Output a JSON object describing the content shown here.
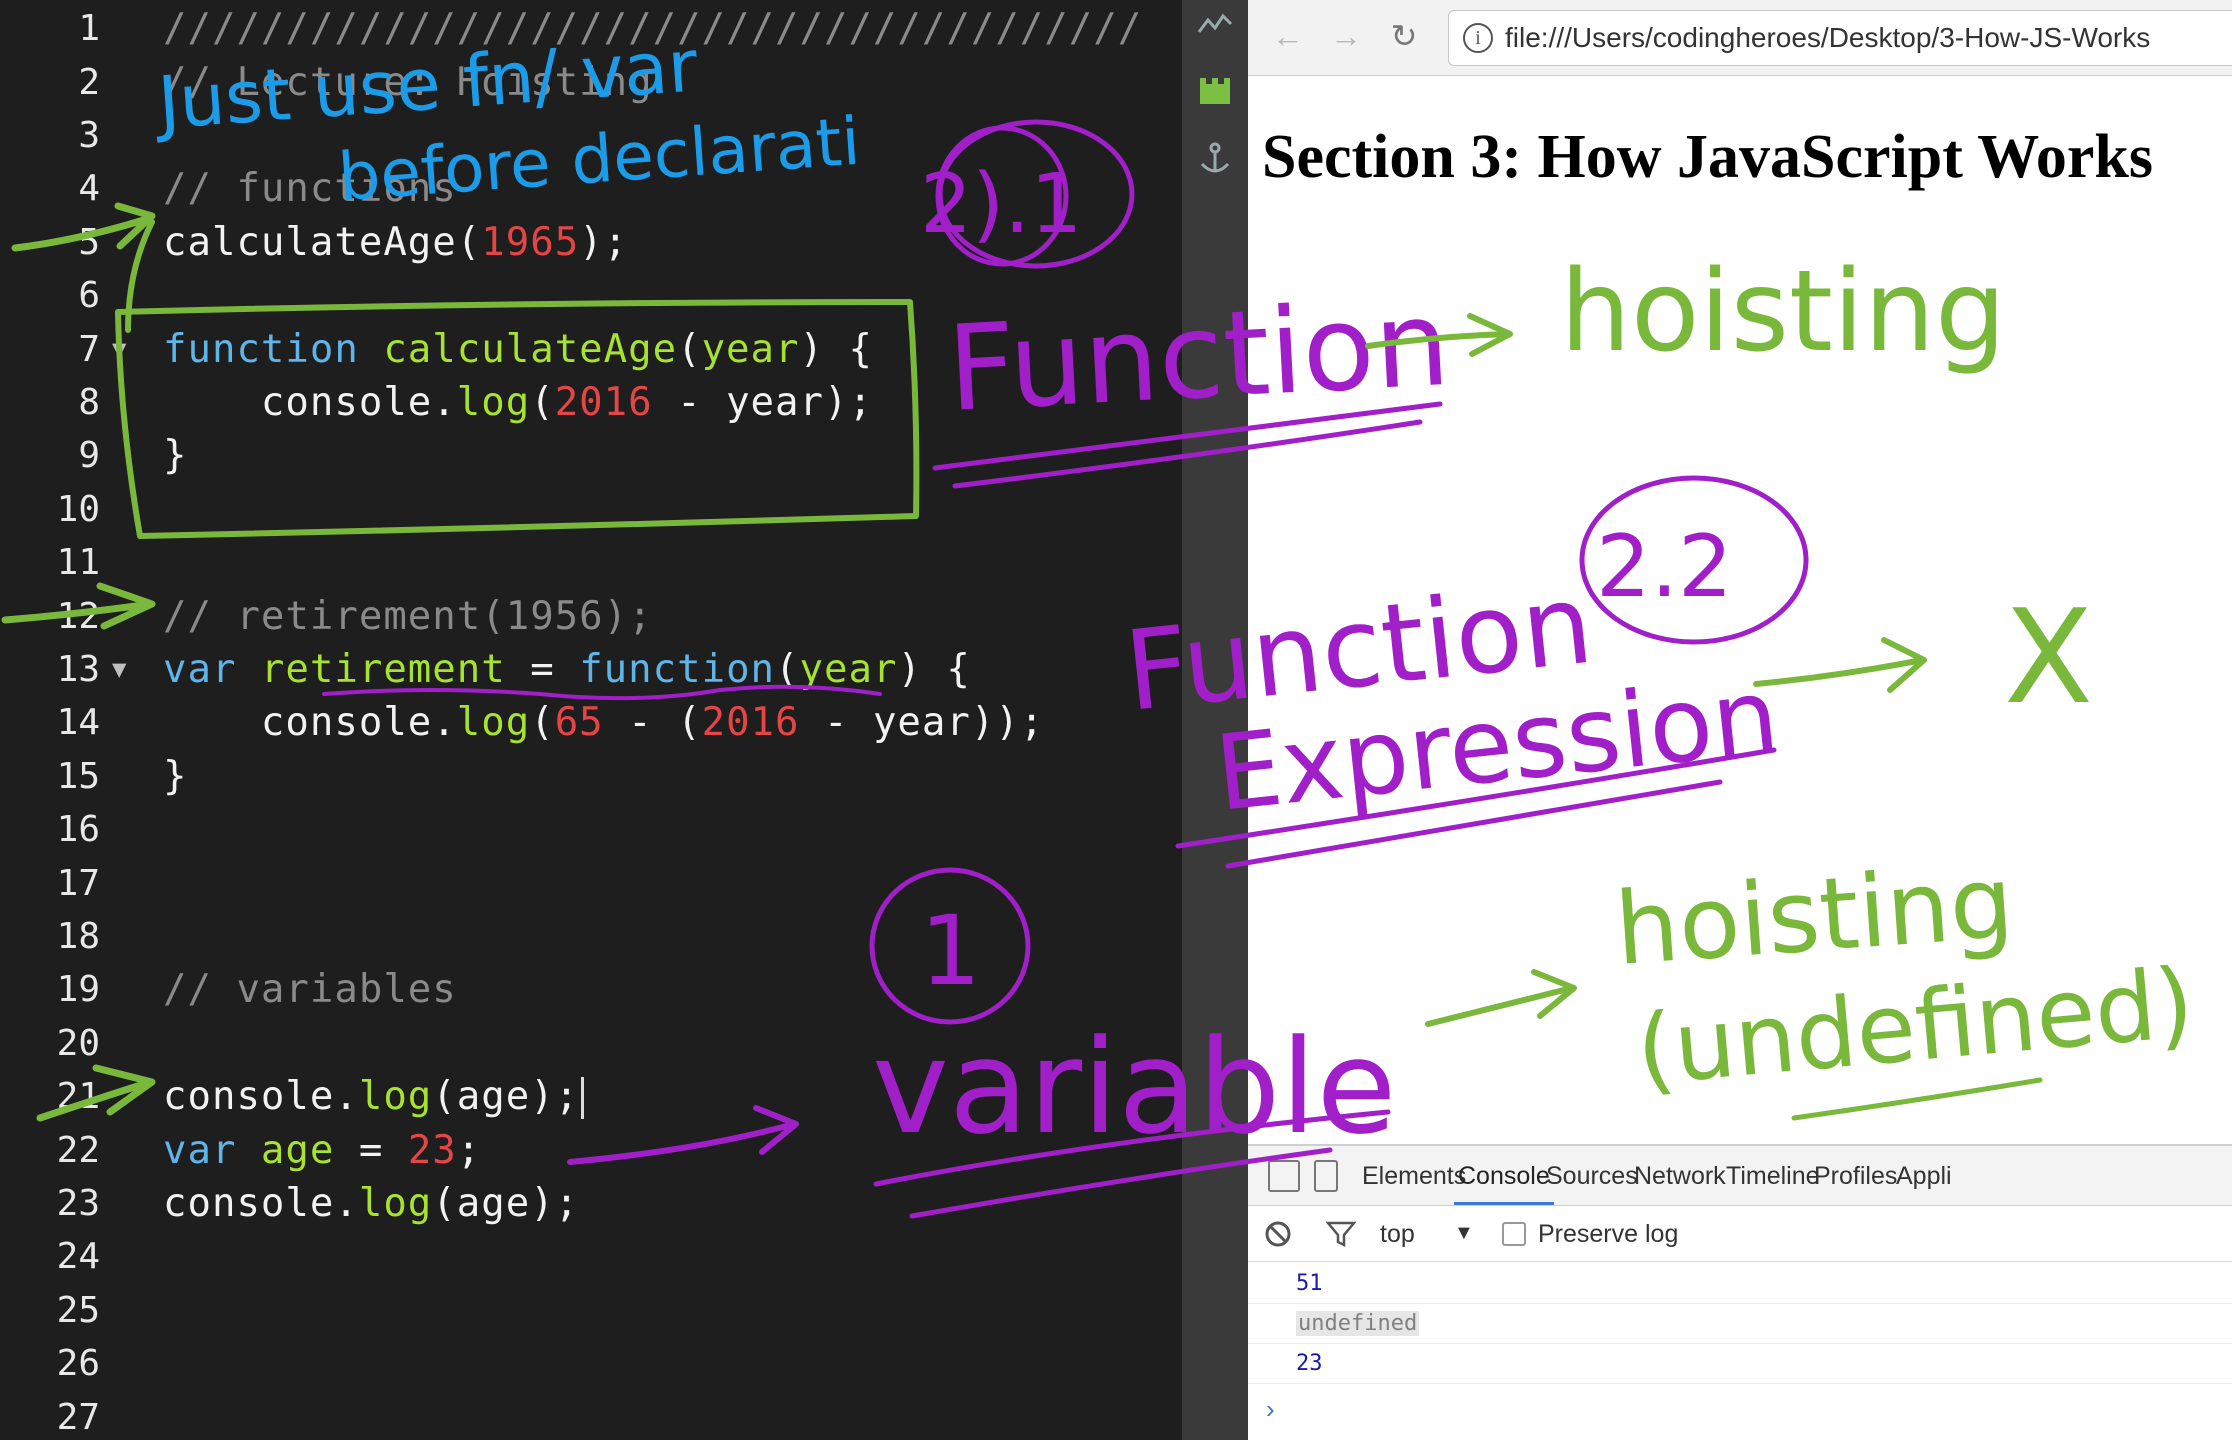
{
  "editor": {
    "lines": [
      {
        "n": "1",
        "tokens": [
          {
            "t": "////////////////////////////////////////",
            "c": "comment"
          }
        ]
      },
      {
        "n": "2",
        "tokens": [
          {
            "t": "// Lecture: Hoisting",
            "c": "comment"
          }
        ]
      },
      {
        "n": "3",
        "tokens": []
      },
      {
        "n": "4",
        "tokens": [
          {
            "t": "// functions",
            "c": "comment"
          }
        ]
      },
      {
        "n": "5",
        "tokens": [
          {
            "t": "calculateAge(",
            "c": "plain"
          },
          {
            "t": "1965",
            "c": "num"
          },
          {
            "t": ");",
            "c": "plain"
          }
        ]
      },
      {
        "n": "6",
        "tokens": []
      },
      {
        "n": "7",
        "fold": true,
        "tokens": [
          {
            "t": "function ",
            "c": "kw"
          },
          {
            "t": "calculateAge",
            "c": "fn"
          },
          {
            "t": "(",
            "c": "plain"
          },
          {
            "t": "year",
            "c": "fn"
          },
          {
            "t": ") {",
            "c": "plain"
          }
        ]
      },
      {
        "n": "8",
        "tokens": [
          {
            "t": "    console.",
            "c": "plain"
          },
          {
            "t": "log",
            "c": "fn"
          },
          {
            "t": "(",
            "c": "plain"
          },
          {
            "t": "2016",
            "c": "num"
          },
          {
            "t": " - year);",
            "c": "plain"
          }
        ]
      },
      {
        "n": "9",
        "tokens": [
          {
            "t": "}",
            "c": "plain"
          }
        ]
      },
      {
        "n": "10",
        "tokens": []
      },
      {
        "n": "11",
        "tokens": []
      },
      {
        "n": "12",
        "tokens": [
          {
            "t": "// retirement(1956);",
            "c": "comment"
          }
        ]
      },
      {
        "n": "13",
        "fold": true,
        "tokens": [
          {
            "t": "var ",
            "c": "kw"
          },
          {
            "t": "retirement",
            "c": "fn"
          },
          {
            "t": " = ",
            "c": "plain"
          },
          {
            "t": "function",
            "c": "kw"
          },
          {
            "t": "(",
            "c": "plain"
          },
          {
            "t": "year",
            "c": "fn"
          },
          {
            "t": ") {",
            "c": "plain"
          }
        ]
      },
      {
        "n": "14",
        "tokens": [
          {
            "t": "    console.",
            "c": "plain"
          },
          {
            "t": "log",
            "c": "fn"
          },
          {
            "t": "(",
            "c": "plain"
          },
          {
            "t": "65",
            "c": "num"
          },
          {
            "t": " - (",
            "c": "plain"
          },
          {
            "t": "2016",
            "c": "num"
          },
          {
            "t": " - year));",
            "c": "plain"
          }
        ]
      },
      {
        "n": "15",
        "tokens": [
          {
            "t": "}",
            "c": "plain"
          }
        ]
      },
      {
        "n": "16",
        "tokens": []
      },
      {
        "n": "17",
        "tokens": []
      },
      {
        "n": "18",
        "tokens": []
      },
      {
        "n": "19",
        "tokens": [
          {
            "t": "// variables",
            "c": "comment"
          }
        ]
      },
      {
        "n": "20",
        "tokens": []
      },
      {
        "n": "21",
        "cursor": true,
        "tokens": [
          {
            "t": "console.",
            "c": "plain"
          },
          {
            "t": "log",
            "c": "fn"
          },
          {
            "t": "(age);",
            "c": "plain"
          }
        ]
      },
      {
        "n": "22",
        "tokens": [
          {
            "t": "var ",
            "c": "kw"
          },
          {
            "t": "age",
            "c": "fn"
          },
          {
            "t": " = ",
            "c": "plain"
          },
          {
            "t": "23",
            "c": "num"
          },
          {
            "t": ";",
            "c": "plain"
          }
        ]
      },
      {
        "n": "23",
        "tokens": [
          {
            "t": "console.",
            "c": "plain"
          },
          {
            "t": "log",
            "c": "fn"
          },
          {
            "t": "(age);",
            "c": "plain"
          }
        ]
      },
      {
        "n": "24",
        "tokens": []
      },
      {
        "n": "25",
        "tokens": []
      },
      {
        "n": "26",
        "tokens": []
      },
      {
        "n": "27",
        "tokens": []
      }
    ]
  },
  "browser": {
    "url": "file:///Users/codingheroes/Desktop/3-How-JS-Works",
    "page_title": "Section 3: How JavaScript Works"
  },
  "devtools": {
    "tabs": [
      "Elements",
      "Console",
      "Sources",
      "Network",
      "Timeline",
      "Profiles",
      "Appli"
    ],
    "active_tab": "Console",
    "context": "top",
    "preserve_log_label": "Preserve log",
    "console_output": [
      "51",
      "undefined",
      "23"
    ]
  },
  "annotations": {
    "blue_note_line1": "Just use fn/ var",
    "blue_note_line2": "before declarati",
    "label_2_1": "2).1",
    "function_label": "Function",
    "function_result": "hoisting",
    "label_2_2": "2.2",
    "function_expr_label1": "Function",
    "function_expr_label2": "Expression",
    "function_expr_result": "X",
    "label_1": "1",
    "variable_label": "variable",
    "variable_result1": "hoisting",
    "variable_result2": "(undefined)"
  },
  "colors": {
    "editor_bg": "#1e1e1e",
    "keyword": "#5fb4e8",
    "function_name": "#a6e22e",
    "number": "#e64545",
    "comment": "#8a8a8a",
    "ink_green": "#7ab83c",
    "ink_purple": "#a11fc9",
    "ink_blue": "#1c9be8"
  }
}
